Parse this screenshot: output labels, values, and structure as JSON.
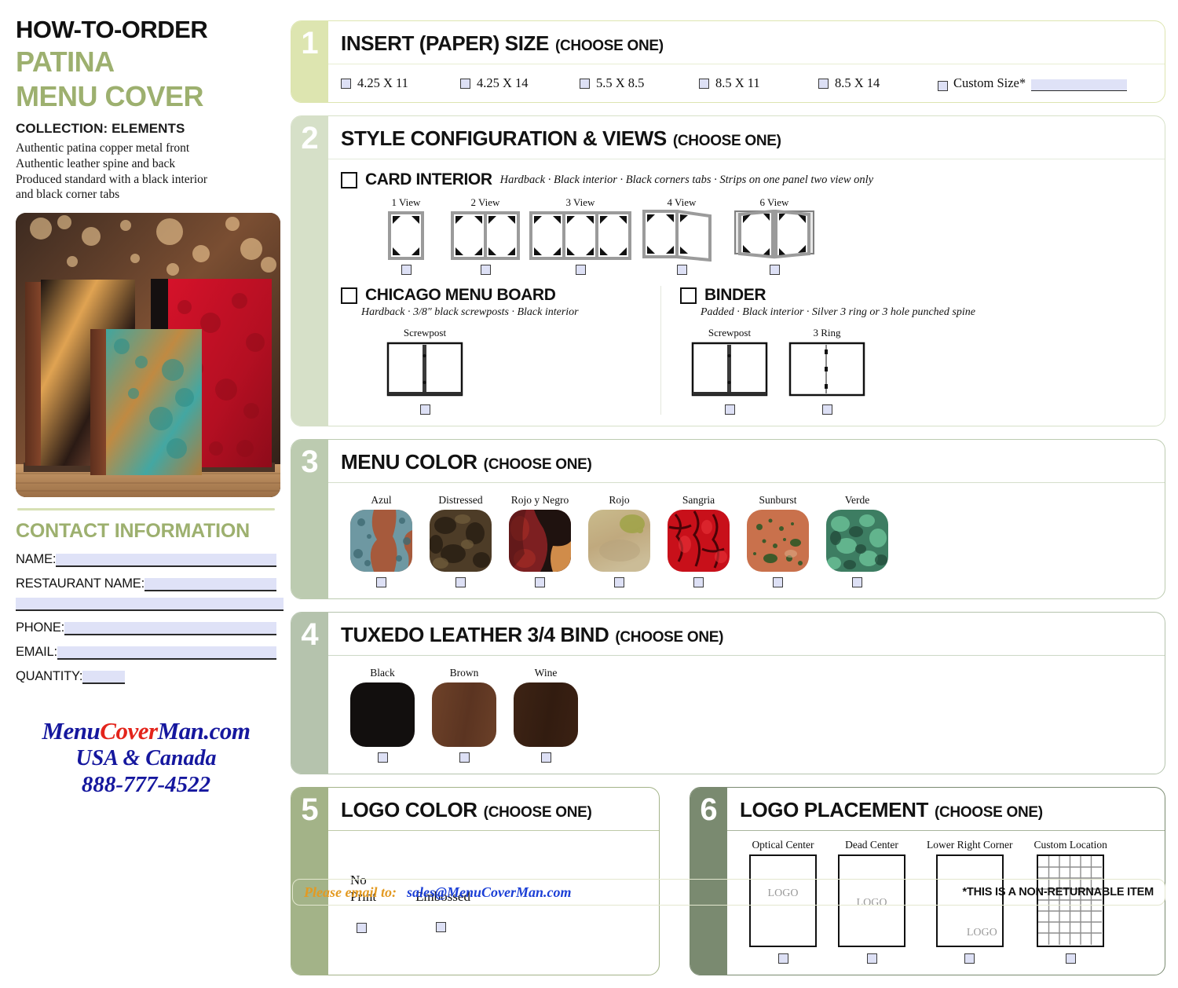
{
  "sidebar": {
    "title_line1": "HOW-TO-ORDER",
    "title_line2": "PATINA",
    "title_line3": "MENU COVER",
    "collection": "COLLECTION: ELEMENTS",
    "description_lines": [
      "Authentic patina copper metal front",
      "Authentic leather spine and back",
      "Produced standard with a black interior",
      "and black corner tabs"
    ],
    "contact_heading": "CONTACT INFORMATION",
    "fields": [
      {
        "label": "NAME:"
      },
      {
        "label": "RESTAURANT NAME:"
      },
      {
        "label": "PHONE:"
      },
      {
        "label": "EMAIL:"
      },
      {
        "label": "QUANTITY:"
      }
    ],
    "brand_pre": "Menu",
    "brand_red": "Cover",
    "brand_post": "Man.com",
    "brand_region": "USA & Canada",
    "brand_phone": "888-777-4522"
  },
  "sections": {
    "s1": {
      "number": "1",
      "title": "INSERT (PAPER) SIZE",
      "subtitle": "(CHOOSE ONE)",
      "badge_color": "#dde5b0",
      "options": [
        "4.25 X 11",
        "4.25 X 14",
        "5.5 X 8.5",
        "8.5 X 11",
        "8.5 X 14"
      ],
      "custom_label": "Custom Size*"
    },
    "s2": {
      "number": "2",
      "title": "STYLE CONFIGURATION & VIEWS",
      "subtitle": "(CHOOSE ONE)",
      "badge_color": "#d6e0c8",
      "card_interior": {
        "label": "CARD INTERIOR",
        "desc": "Hardback · Black interior · Black corners tabs · Strips on one panel two view only",
        "views": [
          "1 View",
          "2 View",
          "3 View",
          "4 View",
          "6 View"
        ]
      },
      "chicago": {
        "label": "CHICAGO MENU BOARD",
        "desc": "Hardback · 3/8\" black screwposts · Black interior",
        "figures": [
          "Screwpost"
        ]
      },
      "binder": {
        "label": "BINDER",
        "desc": "Padded · Black interior · Silver 3 ring or 3 hole punched spine",
        "figures": [
          "Screwpost",
          "3 Ring"
        ]
      }
    },
    "s3": {
      "number": "3",
      "title": "MENU COLOR",
      "subtitle": "(CHOOSE ONE)",
      "badge_color": "#bccbb0",
      "colors": [
        {
          "name": "Azul",
          "hex": "#7b9aa3"
        },
        {
          "name": "Distressed",
          "hex": "#4b3c2a"
        },
        {
          "name": "Rojo y Negro",
          "hex": "#6e2424"
        },
        {
          "name": "Rojo",
          "hex": "#c3b08a"
        },
        {
          "name": "Sangria",
          "hex": "#c21217"
        },
        {
          "name": "Sunburst",
          "hex": "#c9714c"
        },
        {
          "name": "Verde",
          "hex": "#4e9378"
        }
      ]
    },
    "s4": {
      "number": "4",
      "title": "TUXEDO LEATHER 3/4 BIND",
      "subtitle": "(CHOOSE ONE)",
      "badge_color": "#b5c3ad",
      "colors": [
        {
          "name": "Black",
          "hex": "#120f0e"
        },
        {
          "name": "Brown",
          "hex": "#6b4028"
        },
        {
          "name": "Wine",
          "hex": "#3b2113"
        }
      ]
    },
    "s5": {
      "number": "5",
      "title": "LOGO COLOR",
      "subtitle": "(CHOOSE ONE)",
      "badge_color": "#a3b388",
      "options": [
        "No\nPrint",
        "Embossed"
      ],
      "option_labels": [
        [
          "No",
          "Print"
        ],
        [
          "Embossed"
        ]
      ]
    },
    "s6": {
      "number": "6",
      "title": "LOGO PLACEMENT",
      "subtitle": "(CHOOSE ONE)",
      "badge_color": "#7a8a70",
      "placements": [
        {
          "name": "Optical Center",
          "logo_text": "LOGO"
        },
        {
          "name": "Dead Center",
          "logo_text": "LOGO"
        },
        {
          "name": "Lower Right Corner",
          "logo_text": "LOGO"
        },
        {
          "name": "Custom Location",
          "logo_text": ""
        }
      ]
    }
  },
  "footer": {
    "please_email": "Please email to:",
    "email": "sales@MenuCoverMan.com",
    "note": "*THIS IS A NON-RETURNABLE ITEM"
  }
}
